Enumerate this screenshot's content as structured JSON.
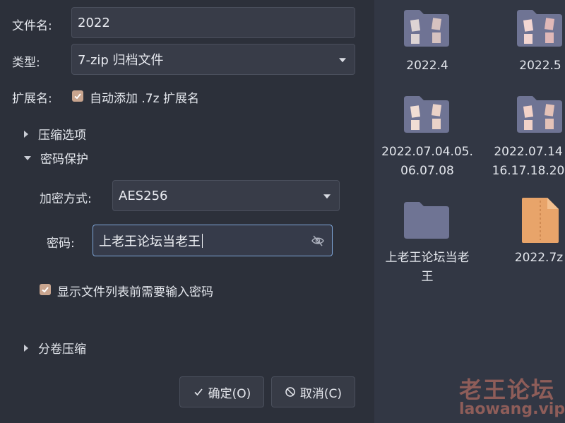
{
  "dialog": {
    "filename_label": "文件名:",
    "filename_value": "2022",
    "type_label": "类型:",
    "type_value": "7-zip 归档文件",
    "ext_label": "扩展名:",
    "ext_checkbox_label": "自动添加 .7z 扩展名",
    "section_compress": "压缩选项",
    "section_password": "密码保护",
    "encrypt_label": "加密方式:",
    "encrypt_value": "AES256",
    "password_label": "密码:",
    "password_value": "上老王论坛当老王",
    "show_list_checkbox_label": "显示文件列表前需要输入密码",
    "section_split": "分卷压缩",
    "ok_button": "确定(O)",
    "cancel_button": "取消(C)"
  },
  "files": [
    {
      "line1": "2022.4",
      "line2": ""
    },
    {
      "line1": "2022.5",
      "line2": ""
    },
    {
      "line1": "2022.07.04.05.",
      "line2": "06.07.08"
    },
    {
      "line1": "2022.07.14",
      "line2": "16.17.18.20"
    },
    {
      "line1": "上老王论坛当老",
      "line2": "王"
    },
    {
      "line1": "2022.7z",
      "line2": ""
    }
  ],
  "watermark": {
    "cn": "老王论坛",
    "en": "laowang.vip"
  },
  "colors": {
    "accent_checkbox": "#c9a58f",
    "focus_border": "#7fa6d8",
    "folder": "#6f7494",
    "archive": "#e8a46a"
  }
}
